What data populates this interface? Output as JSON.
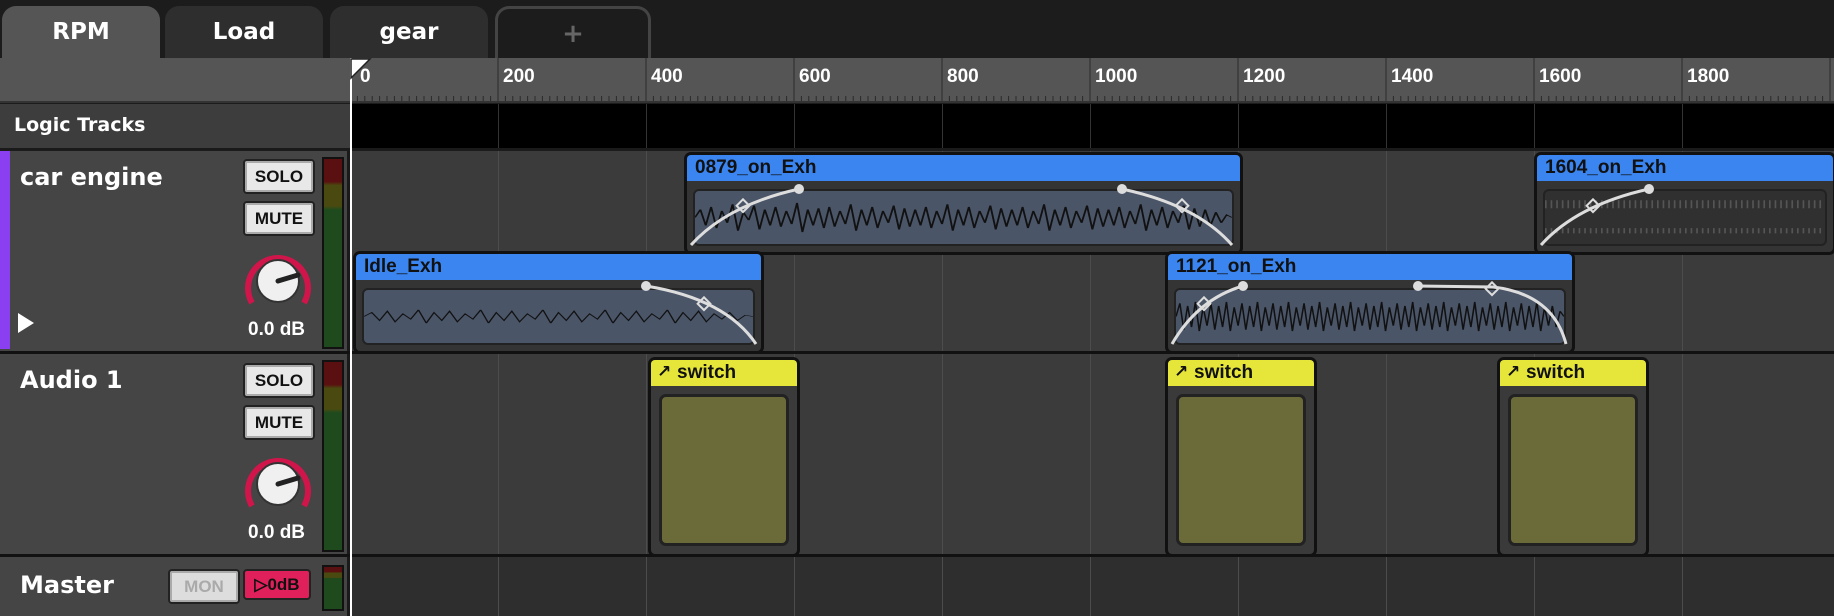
{
  "tabs": [
    {
      "label": "RPM",
      "active": true
    },
    {
      "label": "Load",
      "active": false
    },
    {
      "label": "gear",
      "active": false
    },
    {
      "label": "+",
      "active": false
    }
  ],
  "ruler": {
    "ticks": [
      "0",
      "200",
      "400",
      "600",
      "800",
      "1000",
      "1200",
      "1400",
      "1600",
      "1800"
    ]
  },
  "logic_tracks": {
    "label": "Logic Tracks"
  },
  "tracks": [
    {
      "name": "car engine",
      "color": "#8a3ff0",
      "solo_label": "SOLO",
      "mute_label": "MUTE",
      "volume_label": "0.0 dB",
      "clips": [
        {
          "name": "0879_on_Exh"
        },
        {
          "name": "1604_on_Exh"
        },
        {
          "name": "Idle_Exh"
        },
        {
          "name": "1121_on_Exh"
        }
      ]
    },
    {
      "name": "Audio 1",
      "solo_label": "SOLO",
      "mute_label": "MUTE",
      "volume_label": "0.0 dB",
      "clips": [
        {
          "name": "switch"
        },
        {
          "name": "switch"
        },
        {
          "name": "switch"
        }
      ]
    }
  ],
  "master": {
    "name": "Master",
    "mon_label": "MON",
    "level_label": "0dB"
  },
  "colors": {
    "clip_header": "#3a85f0",
    "switch_header": "#e6e63a",
    "knob_ring": "#d0154a",
    "playhead": "#ffffff"
  }
}
